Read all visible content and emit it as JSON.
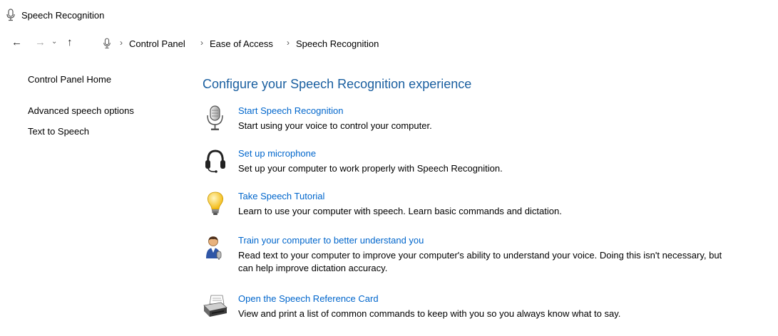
{
  "window": {
    "title": "Speech Recognition"
  },
  "nav": {
    "back_glyph": "←",
    "forward_glyph": "→",
    "recent_glyph": "⌄",
    "up_glyph": "↑",
    "breadcrumb_separator": "›",
    "breadcrumbs": [
      "Control Panel",
      "Ease of Access",
      "Speech Recognition"
    ]
  },
  "sidebar": {
    "items": [
      "Control Panel Home",
      "Advanced speech options",
      "Text to Speech"
    ]
  },
  "main": {
    "heading": "Configure your Speech Recognition experience",
    "tasks": [
      {
        "icon": "microphone-icon",
        "title": "Start Speech Recognition",
        "description": "Start using your voice to control your computer."
      },
      {
        "icon": "headset-icon",
        "title": "Set up microphone",
        "description": "Set up your computer to work properly with Speech Recognition."
      },
      {
        "icon": "lightbulb-icon",
        "title": "Take Speech Tutorial",
        "description": "Learn to use your computer with speech.  Learn basic commands and dictation."
      },
      {
        "icon": "user-train-icon",
        "title": "Train your computer to better understand you",
        "description": "Read text to your computer to improve your computer's ability to understand your voice.  Doing this isn't necessary, but can help improve dictation accuracy."
      },
      {
        "icon": "printer-icon",
        "title": "Open the Speech Reference Card",
        "description": "View and print a list of common commands to keep with you so you always know what to say."
      }
    ]
  },
  "colors": {
    "heading": "#1a5fa0",
    "link": "#0066cc"
  }
}
